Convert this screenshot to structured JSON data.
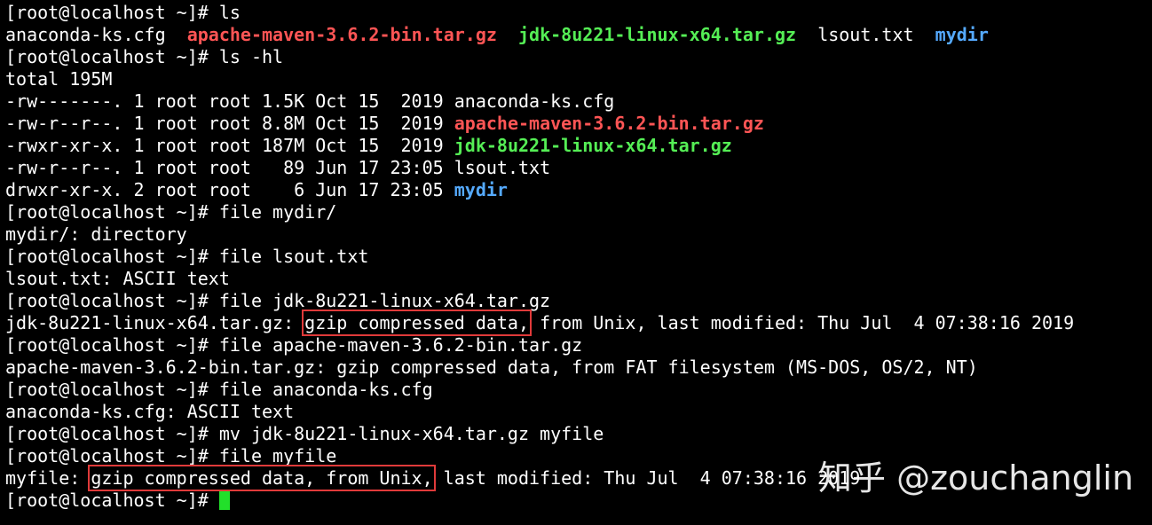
{
  "prompt": "[root@localhost ~]# ",
  "lines": {
    "l1": {
      "cmd": "ls"
    },
    "l2": {
      "f1": "anaconda-ks.cfg",
      "gap1": "  ",
      "f2": "apache-maven-3.6.2-bin.tar.gz",
      "gap2": "  ",
      "f3": "jdk-8u221-linux-x64.tar.gz",
      "gap3": "  ",
      "f4": "lsout.txt",
      "gap4": "  ",
      "f5": "mydir"
    },
    "l3": {
      "cmd": "ls -hl"
    },
    "l4": {
      "text": "total 195M"
    },
    "l5": {
      "meta": "-rw-------. 1 root root 1.5K Oct 15  2019 ",
      "name": "anaconda-ks.cfg"
    },
    "l6": {
      "meta": "-rw-r--r--. 1 root root 8.8M Oct 15  2019 ",
      "name": "apache-maven-3.6.2-bin.tar.gz"
    },
    "l7": {
      "meta": "-rwxr-xr-x. 1 root root 187M Oct 15  2019 ",
      "name": "jdk-8u221-linux-x64.tar.gz"
    },
    "l8": {
      "meta": "-rw-r--r--. 1 root root   89 Jun 17 23:05 ",
      "name": "lsout.txt"
    },
    "l9": {
      "meta": "drwxr-xr-x. 2 root root    6 Jun 17 23:05 ",
      "name": "mydir"
    },
    "l10": {
      "cmd": "file mydir/"
    },
    "l11": {
      "text": "mydir/: directory"
    },
    "l12": {
      "cmd": "file lsout.txt"
    },
    "l13": {
      "text": "lsout.txt: ASCII text"
    },
    "l14": {
      "cmd": "file jdk-8u221-linux-x64.tar.gz"
    },
    "l15": {
      "pre": "jdk-8u221-linux-x64.tar.gz: ",
      "boxed": "gzip compressed data,",
      "post": " from Unix, last modified: Thu Jul  4 07:38:16 2019"
    },
    "l16": {
      "cmd": "file apache-maven-3.6.2-bin.tar.gz"
    },
    "l17": {
      "text": "apache-maven-3.6.2-bin.tar.gz: gzip compressed data, from FAT filesystem (MS-DOS, OS/2, NT)"
    },
    "l18": {
      "cmd": "file anaconda-ks.cfg"
    },
    "l19": {
      "text": "anaconda-ks.cfg: ASCII text"
    },
    "l20": {
      "cmd": "mv jdk-8u221-linux-x64.tar.gz myfile"
    },
    "l21": {
      "cmd": "file myfile"
    },
    "l22": {
      "pre": "myfile: ",
      "boxed": "gzip compressed data, from Unix,",
      "post": " last modified: Thu Jul  4 07:38:16 2019"
    },
    "l23": {
      "cmd": ""
    }
  },
  "watermark": {
    "logo": "知乎",
    "handle": " @zouchanglin"
  },
  "colors": {
    "background": "#000000",
    "text": "#ffffff",
    "archive": "#ff5555",
    "executable": "#55ee55",
    "directory": "#55aaff",
    "highlight_box": "#e03a3a",
    "cursor": "#22e02a"
  }
}
